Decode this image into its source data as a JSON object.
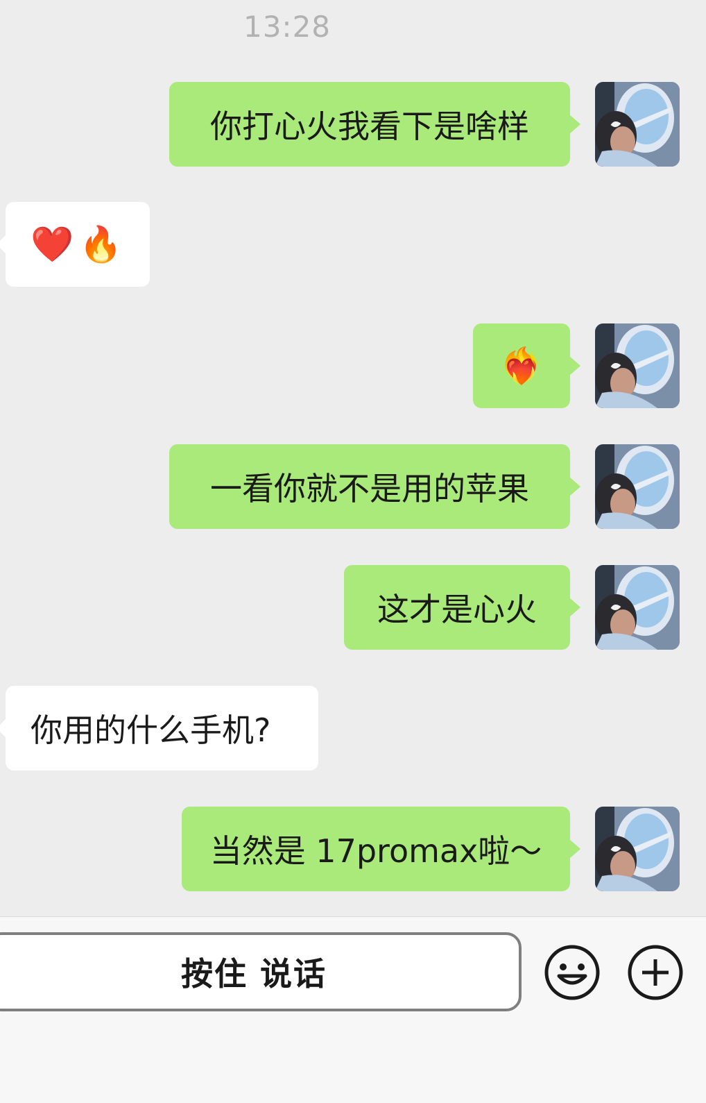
{
  "timestamp": "13:28",
  "messages": [
    {
      "side": "out",
      "text": "你打心火我看下是啥样"
    },
    {
      "side": "in",
      "emoji1": "❤️",
      "emoji2": "🔥"
    },
    {
      "side": "out",
      "emoji": "❤️‍🔥"
    },
    {
      "side": "out",
      "text": "一看你就不是用的苹果"
    },
    {
      "side": "out",
      "text": "这才是心火"
    },
    {
      "side": "in",
      "text": "你用的什么手机?"
    },
    {
      "side": "out",
      "text": "当然是 17promax啦～"
    }
  ],
  "input_bar": {
    "hold_to_talk_label": "按住 说话",
    "emoji_icon": "smiley-icon",
    "plus_icon": "plus-circle-icon"
  },
  "colors": {
    "outgoing_bubble": "#a9ea7a",
    "incoming_bubble": "#ffffff",
    "background": "#ededed"
  }
}
